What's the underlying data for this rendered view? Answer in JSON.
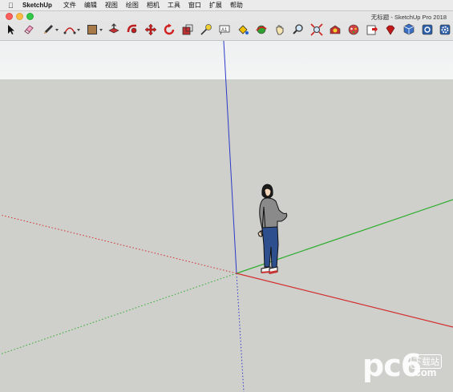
{
  "menubar": {
    "app_name": "SketchUp",
    "items": [
      "文件",
      "编辑",
      "视图",
      "绘图",
      "相机",
      "工具",
      "窗口",
      "扩展",
      "帮助"
    ]
  },
  "window": {
    "title": "无标题 - SketchUp Pro 2018"
  },
  "toolbar": {
    "tools": [
      {
        "name": "select-tool",
        "icon": "arrow-icon"
      },
      {
        "name": "eraser-tool",
        "icon": "eraser-icon"
      },
      {
        "name": "pencil-line-tool",
        "icon": "pencil-icon"
      },
      {
        "name": "arc-tool",
        "icon": "arc-icon"
      },
      {
        "name": "rectangle-tool",
        "icon": "rectangle-icon"
      },
      {
        "name": "push-pull-tool",
        "icon": "push-pull-icon"
      },
      {
        "name": "follow-me-tool",
        "icon": "follow-me-icon"
      },
      {
        "name": "move-tool",
        "icon": "move-icon"
      },
      {
        "name": "rotate-tool",
        "icon": "rotate-icon"
      },
      {
        "name": "scale-tool",
        "icon": "scale-icon"
      },
      {
        "name": "tape-measure-tool",
        "icon": "tape-measure-icon"
      },
      {
        "name": "text-tool",
        "icon": "text-icon"
      },
      {
        "name": "paint-bucket-tool",
        "icon": "paint-bucket-icon"
      },
      {
        "name": "orbit-tool",
        "icon": "orbit-icon"
      },
      {
        "name": "pan-tool",
        "icon": "hand-icon"
      },
      {
        "name": "zoom-tool",
        "icon": "magnifier-icon"
      },
      {
        "name": "zoom-extents-tool",
        "icon": "zoom-extents-icon"
      },
      {
        "name": "3d-warehouse-tool",
        "icon": "warehouse-icon"
      },
      {
        "name": "extension-warehouse-tool",
        "icon": "extension-icon"
      },
      {
        "name": "send-to-layout-tool",
        "icon": "layout-icon"
      },
      {
        "name": "ruby-console-tool",
        "icon": "ruby-icon"
      },
      {
        "name": "component-tool",
        "icon": "component-icon"
      },
      {
        "name": "export-tool",
        "icon": "export-icon"
      },
      {
        "name": "settings-tool",
        "icon": "gear-icon"
      }
    ]
  },
  "colors": {
    "axis_red": "#d23030",
    "axis_green": "#2fae2f",
    "axis_blue": "#2b3bc8",
    "sky": "#f1f2f2",
    "ground": "#cfcfcb"
  },
  "watermark": {
    "brand": "pc6",
    "badge": "下载站",
    "domain": ".com"
  }
}
